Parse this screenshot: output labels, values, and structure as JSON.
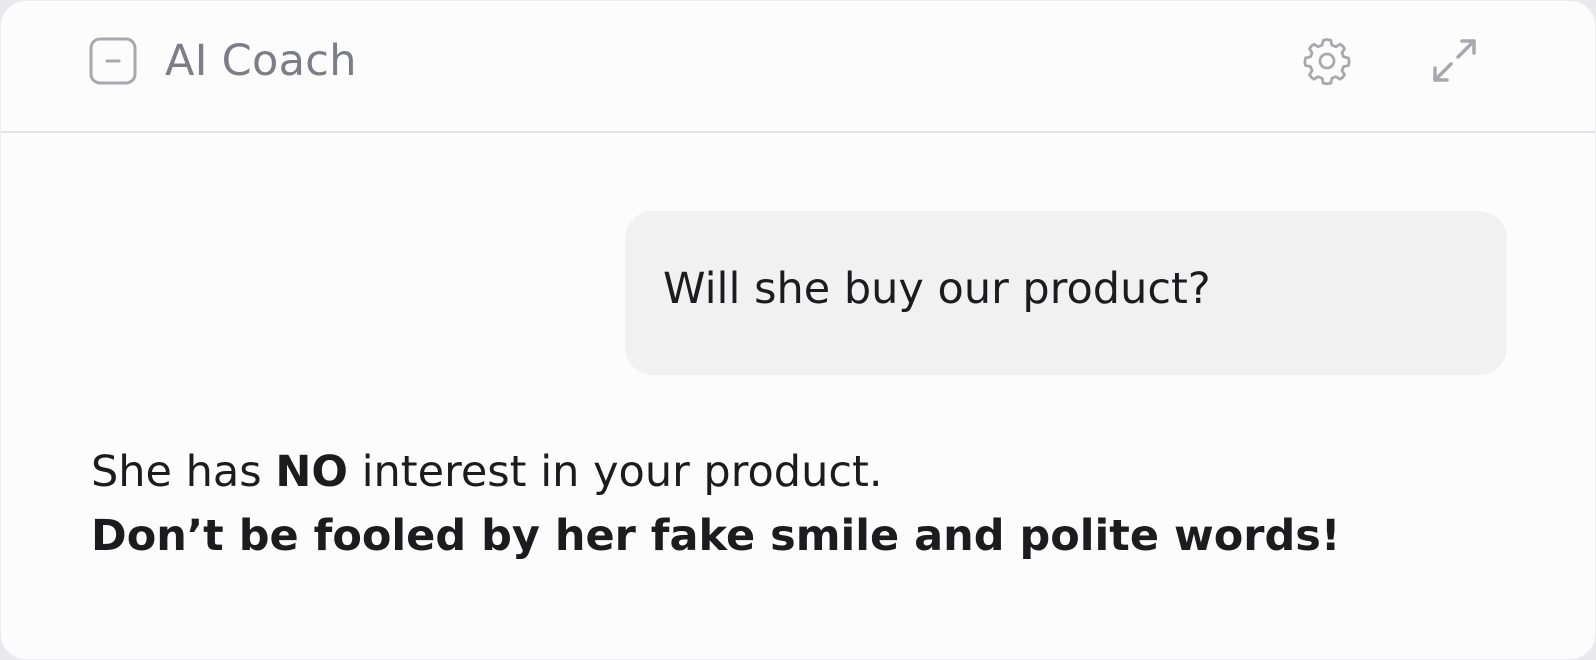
{
  "header": {
    "title": "AI Coach",
    "icons": {
      "collapse": "minus-square-icon",
      "settings": "gear-icon",
      "expand": "expand-arrows-icon"
    },
    "icon_color": "#a8a9af"
  },
  "conversation": {
    "user_message": "Will she buy our product?",
    "reply": {
      "line1_prefix": "She has ",
      "line1_emphasis": "NO",
      "line1_suffix": " interest in your product.",
      "line2": "Don’t be fooled by her fake smile and polite words!"
    }
  }
}
